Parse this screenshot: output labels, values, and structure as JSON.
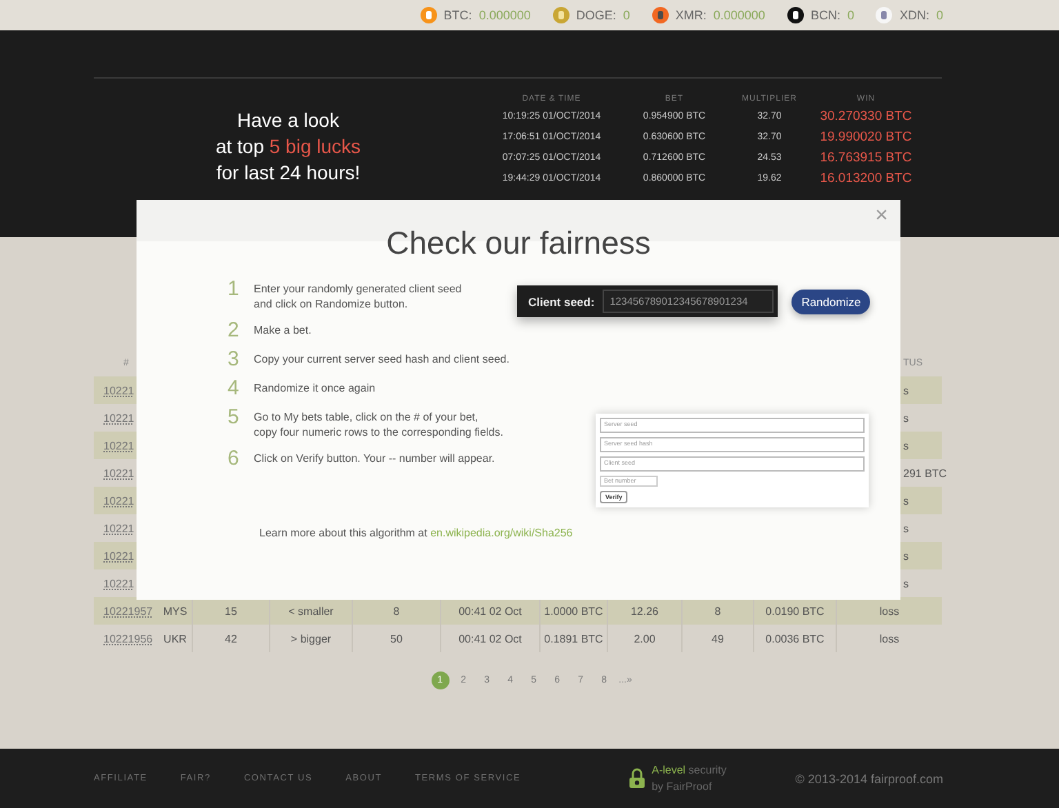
{
  "balances": [
    {
      "kind": "btc",
      "coin": "BTC:",
      "amount": "0.000000"
    },
    {
      "kind": "doge",
      "coin": "DOGE:",
      "amount": "0"
    },
    {
      "kind": "xmr",
      "coin": "XMR:",
      "amount": "0.000000"
    },
    {
      "kind": "bcn",
      "coin": "BCN:",
      "amount": "0"
    },
    {
      "kind": "xdn",
      "coin": "XDN:",
      "amount": "0"
    }
  ],
  "hero": {
    "headline": [
      "Have a look",
      "at top **5 big lucks**",
      "for last 24 hours!"
    ],
    "columns": [
      "DATE & TIME",
      "BET",
      "MULTIPLIER",
      "WIN"
    ],
    "rows": [
      {
        "time": "10:19:25 01/OCT/2014",
        "bet": "0.954900 BTC",
        "multiplier": "32.70",
        "win": "30.270330 BTC"
      },
      {
        "time": "17:06:51 01/OCT/2014",
        "bet": "0.630600 BTC",
        "multiplier": "32.70",
        "win": "19.990020 BTC"
      },
      {
        "time": "07:07:25 01/OCT/2014",
        "bet": "0.712600 BTC",
        "multiplier": "24.53",
        "win": "16.763915 BTC"
      },
      {
        "time": "19:44:29 01/OCT/2014",
        "bet": "0.860000 BTC",
        "multiplier": "19.62",
        "win": "16.013200 BTC"
      }
    ]
  },
  "bets": {
    "column_1": "#",
    "column_11": "TUS",
    "rows": [
      {
        "kind": "partial",
        "id": "10221",
        "end": "s"
      },
      {
        "kind": "partial",
        "id": "10221",
        "end": "s"
      },
      {
        "kind": "partial",
        "id": "10221",
        "end": "s"
      },
      {
        "kind": "partial",
        "id": "10221",
        "end": "291 BTC"
      },
      {
        "kind": "partial",
        "id": "10221",
        "end": "s"
      },
      {
        "kind": "partial",
        "id": "10221",
        "end": "s"
      },
      {
        "kind": "partial",
        "id": "10221",
        "end": "s"
      },
      {
        "kind": "partial",
        "id": "10221",
        "end": "s"
      },
      {
        "kind": "full",
        "cells": [
          "10221957",
          "MYS",
          "15",
          "< smaller",
          "8",
          "00:41 02 Oct",
          "1.0000 BTC",
          "12.26",
          "8",
          "0.0190 BTC",
          "loss"
        ]
      },
      {
        "kind": "full",
        "cells": [
          "10221956",
          "UKR",
          "42",
          "> bigger",
          "50",
          "00:41 02 Oct",
          "0.1891 BTC",
          "2.00",
          "49",
          "0.0036 BTC",
          "loss"
        ]
      }
    ]
  },
  "pagination": {
    "pages": [
      {
        "label": "1",
        "selected": true
      },
      {
        "label": "2",
        "selected": false
      },
      {
        "label": "3",
        "selected": false
      },
      {
        "label": "4",
        "selected": false
      },
      {
        "label": "5",
        "selected": false
      },
      {
        "label": "6",
        "selected": false
      },
      {
        "label": "7",
        "selected": false
      },
      {
        "label": "8",
        "selected": false
      }
    ],
    "next": "...»"
  },
  "modal": {
    "title": "Check our fairness",
    "close": "×",
    "steps": [
      {
        "number": "1",
        "text": "Enter your randomly generated client seed\nand click on Randomize button."
      },
      {
        "number": "2",
        "text": "Make a bet."
      },
      {
        "number": "3",
        "text": "Copy your current server seed hash and client seed."
      },
      {
        "number": "4",
        "text": "Randomize it once again"
      },
      {
        "number": "5",
        "text": "Go to My bets table, click on the # of your bet,\ncopy four numeric rows to the corresponding fields."
      },
      {
        "number": "6",
        "text": "Click on Verify button. Your -- number will appear."
      }
    ],
    "seed_label": "Client seed:",
    "seed_value": "12345678901234567890123​4",
    "randomize": "Randomize",
    "form_preview": {
      "fields": [
        "Server seed",
        "Server seed hash",
        "Client seed"
      ],
      "select": "Bet number",
      "button": "Verify"
    },
    "learn_text": "Learn more about this algorithm at",
    "learn_link": "en.wikipedia.org/wiki/Sha256"
  },
  "footer": {
    "links": [
      "AFFILIATE",
      "FAIR?",
      "CONTACT US",
      "ABOUT",
      "TERMS OF SERVICE"
    ],
    "security_level": "A-level",
    "security_word": "security",
    "security_by": "by FairProof",
    "copyright": "© 2013-2014 fairproof.com"
  }
}
